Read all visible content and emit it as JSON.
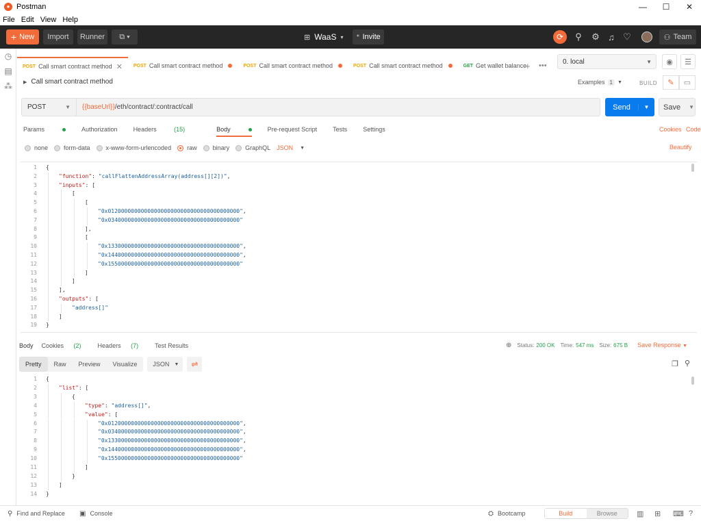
{
  "window": {
    "title": "Postman",
    "minimize": "—",
    "maximize": "☐",
    "close": "✕"
  },
  "menu": [
    "File",
    "Edit",
    "View",
    "Help"
  ],
  "toolbar": {
    "new_label": "New",
    "import_label": "Import",
    "runner_label": "Runner",
    "workspace": "WaaS",
    "invite_label": "Invite",
    "team_label": "Team"
  },
  "tabs": [
    {
      "method": "POST",
      "label": "Call smart contract method",
      "active": true
    },
    {
      "method": "POST",
      "label": "Call smart contract method"
    },
    {
      "method": "POST",
      "label": "Call smart contract method"
    },
    {
      "method": "POST",
      "label": "Call smart contract method"
    },
    {
      "method": "GET",
      "label": "Get wallet balance"
    }
  ],
  "environment": "0. local",
  "request": {
    "name": "Call smart contract method",
    "examples_label": "Examples",
    "examples_count": "1",
    "build_label": "BUILD",
    "method": "POST",
    "url_var": "{{baseUrl}}",
    "url_path": "/eth/contract/:contract/call",
    "send_label": "Send",
    "save_label": "Save"
  },
  "request_tabs": {
    "params": "Params",
    "authorization": "Authorization",
    "headers": "Headers",
    "headers_count": "(15)",
    "body": "Body",
    "prerequest": "Pre-request Script",
    "tests": "Tests",
    "settings": "Settings",
    "cookies": "Cookies",
    "code": "Code"
  },
  "body_options": {
    "none": "none",
    "form_data": "form-data",
    "urlencoded": "x-www-form-urlencoded",
    "raw": "raw",
    "binary": "binary",
    "graphql": "GraphQL",
    "format": "JSON",
    "beautify": "Beautify"
  },
  "request_body": [
    [
      [
        "p",
        "{"
      ]
    ],
    [
      [
        "k",
        "\"function\""
      ],
      [
        "p",
        ": "
      ],
      [
        "s",
        "\"callFlattenAddressArray(address[][2])\""
      ],
      [
        "p",
        ","
      ]
    ],
    [
      [
        "k",
        "\"inputs\""
      ],
      [
        "p",
        ": ["
      ]
    ],
    [
      [
        "p",
        "["
      ]
    ],
    [
      [
        "p",
        "["
      ]
    ],
    [
      [
        "s",
        "\"0x0120000000000000000000000000000000000000\""
      ],
      [
        "p",
        ","
      ]
    ],
    [
      [
        "s",
        "\"0x0340000000000000000000000000000000000000\""
      ]
    ],
    [
      [
        "p",
        "],"
      ]
    ],
    [
      [
        "p",
        "["
      ]
    ],
    [
      [
        "s",
        "\"0x1330000000000000000000000000000000000000\""
      ],
      [
        "p",
        ","
      ]
    ],
    [
      [
        "s",
        "\"0x1440000000000000000000000000000000000000\""
      ],
      [
        "p",
        ","
      ]
    ],
    [
      [
        "s",
        "\"0x1550000000000000000000000000000000000000\""
      ]
    ],
    [
      [
        "p",
        "]"
      ]
    ],
    [
      [
        "p",
        "]"
      ]
    ],
    [
      [
        "p",
        "],"
      ]
    ],
    [
      [
        "k",
        "\"outputs\""
      ],
      [
        "p",
        ": ["
      ]
    ],
    [
      [
        "s",
        "\"address[]\""
      ]
    ],
    [
      [
        "p",
        "]"
      ]
    ],
    [
      [
        "p",
        "}"
      ]
    ]
  ],
  "request_body_indent": [
    0,
    1,
    1,
    2,
    3,
    4,
    4,
    3,
    3,
    4,
    4,
    4,
    3,
    2,
    1,
    1,
    2,
    1,
    0
  ],
  "response_tabs": {
    "body": "Body",
    "cookies": "Cookies",
    "cookies_count": "(2)",
    "headers": "Headers",
    "headers_count": "(7)",
    "test_results": "Test Results"
  },
  "response_status": {
    "status_label": "Status:",
    "status": "200 OK",
    "time_label": "Time:",
    "time": "547 ms",
    "size_label": "Size:",
    "size": "675 B",
    "save_response": "Save Response"
  },
  "response_view": {
    "pretty": "Pretty",
    "raw": "Raw",
    "preview": "Preview",
    "visualize": "Visualize",
    "format": "JSON"
  },
  "response_body": [
    [
      [
        "p",
        "{"
      ]
    ],
    [
      [
        "k",
        "\"list\""
      ],
      [
        "p",
        ": ["
      ]
    ],
    [
      [
        "p",
        "{"
      ]
    ],
    [
      [
        "k",
        "\"type\""
      ],
      [
        "p",
        ": "
      ],
      [
        "s",
        "\"address[]\""
      ],
      [
        "p",
        ","
      ]
    ],
    [
      [
        "k",
        "\"value\""
      ],
      [
        "p",
        ": ["
      ]
    ],
    [
      [
        "s",
        "\"0x0120000000000000000000000000000000000000\""
      ],
      [
        "p",
        ","
      ]
    ],
    [
      [
        "s",
        "\"0x0340000000000000000000000000000000000000\""
      ],
      [
        "p",
        ","
      ]
    ],
    [
      [
        "s",
        "\"0x1330000000000000000000000000000000000000\""
      ],
      [
        "p",
        ","
      ]
    ],
    [
      [
        "s",
        "\"0x1440000000000000000000000000000000000000\""
      ],
      [
        "p",
        ","
      ]
    ],
    [
      [
        "s",
        "\"0x1550000000000000000000000000000000000000\""
      ]
    ],
    [
      [
        "p",
        "]"
      ]
    ],
    [
      [
        "p",
        "}"
      ]
    ],
    [
      [
        "p",
        "]"
      ]
    ],
    [
      [
        "p",
        "}"
      ]
    ]
  ],
  "response_body_indent": [
    0,
    1,
    2,
    3,
    3,
    4,
    4,
    4,
    4,
    4,
    3,
    2,
    1,
    0
  ],
  "footer": {
    "find_replace": "Find and Replace",
    "console": "Console",
    "bootcamp": "Bootcamp",
    "build": "Build",
    "browse": "Browse"
  }
}
